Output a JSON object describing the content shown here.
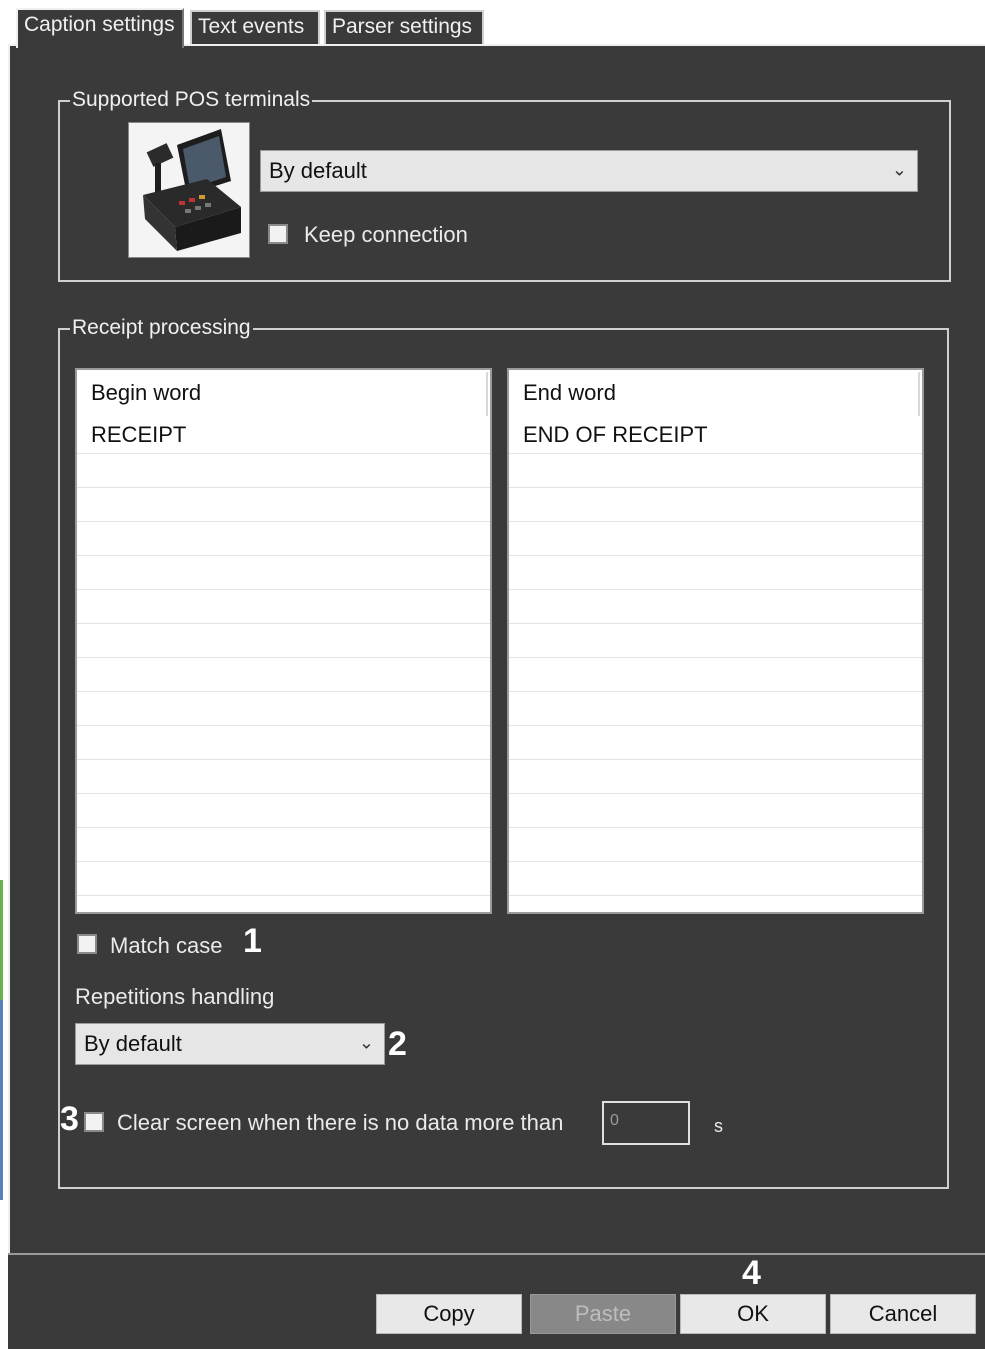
{
  "tabs": [
    {
      "label": "Caption settings",
      "active": true
    },
    {
      "label": "Text events",
      "active": false
    },
    {
      "label": "Parser settings",
      "active": false
    }
  ],
  "supported_pos": {
    "title": "Supported POS terminals",
    "image_icon": "pos-terminal-icon",
    "terminal_select": "By default",
    "keep_connection_label": "Keep connection",
    "keep_connection_checked": false
  },
  "receipt_processing": {
    "title": "Receipt processing",
    "begin_header": "Begin word",
    "begin_values": [
      "RECEIPT"
    ],
    "end_header": "End word",
    "end_values": [
      "END OF RECEIPT"
    ],
    "match_case_label": "Match case",
    "match_case_checked": false,
    "repetitions_label": "Repetitions handling",
    "repetitions_select": "By default",
    "clear_screen_label": "Clear screen when there is no data more than",
    "clear_screen_checked": false,
    "clear_screen_value": "0",
    "clear_screen_unit": "s"
  },
  "markers": {
    "m1": "1",
    "m2": "2",
    "m3": "3",
    "m4": "4"
  },
  "buttons": {
    "copy": "Copy",
    "paste": "Paste",
    "ok": "OK",
    "cancel": "Cancel"
  },
  "colors": {
    "panel_bg": "#3a3a3a",
    "list_bg": "#ffffff",
    "control_bg": "#e6e6e6"
  }
}
